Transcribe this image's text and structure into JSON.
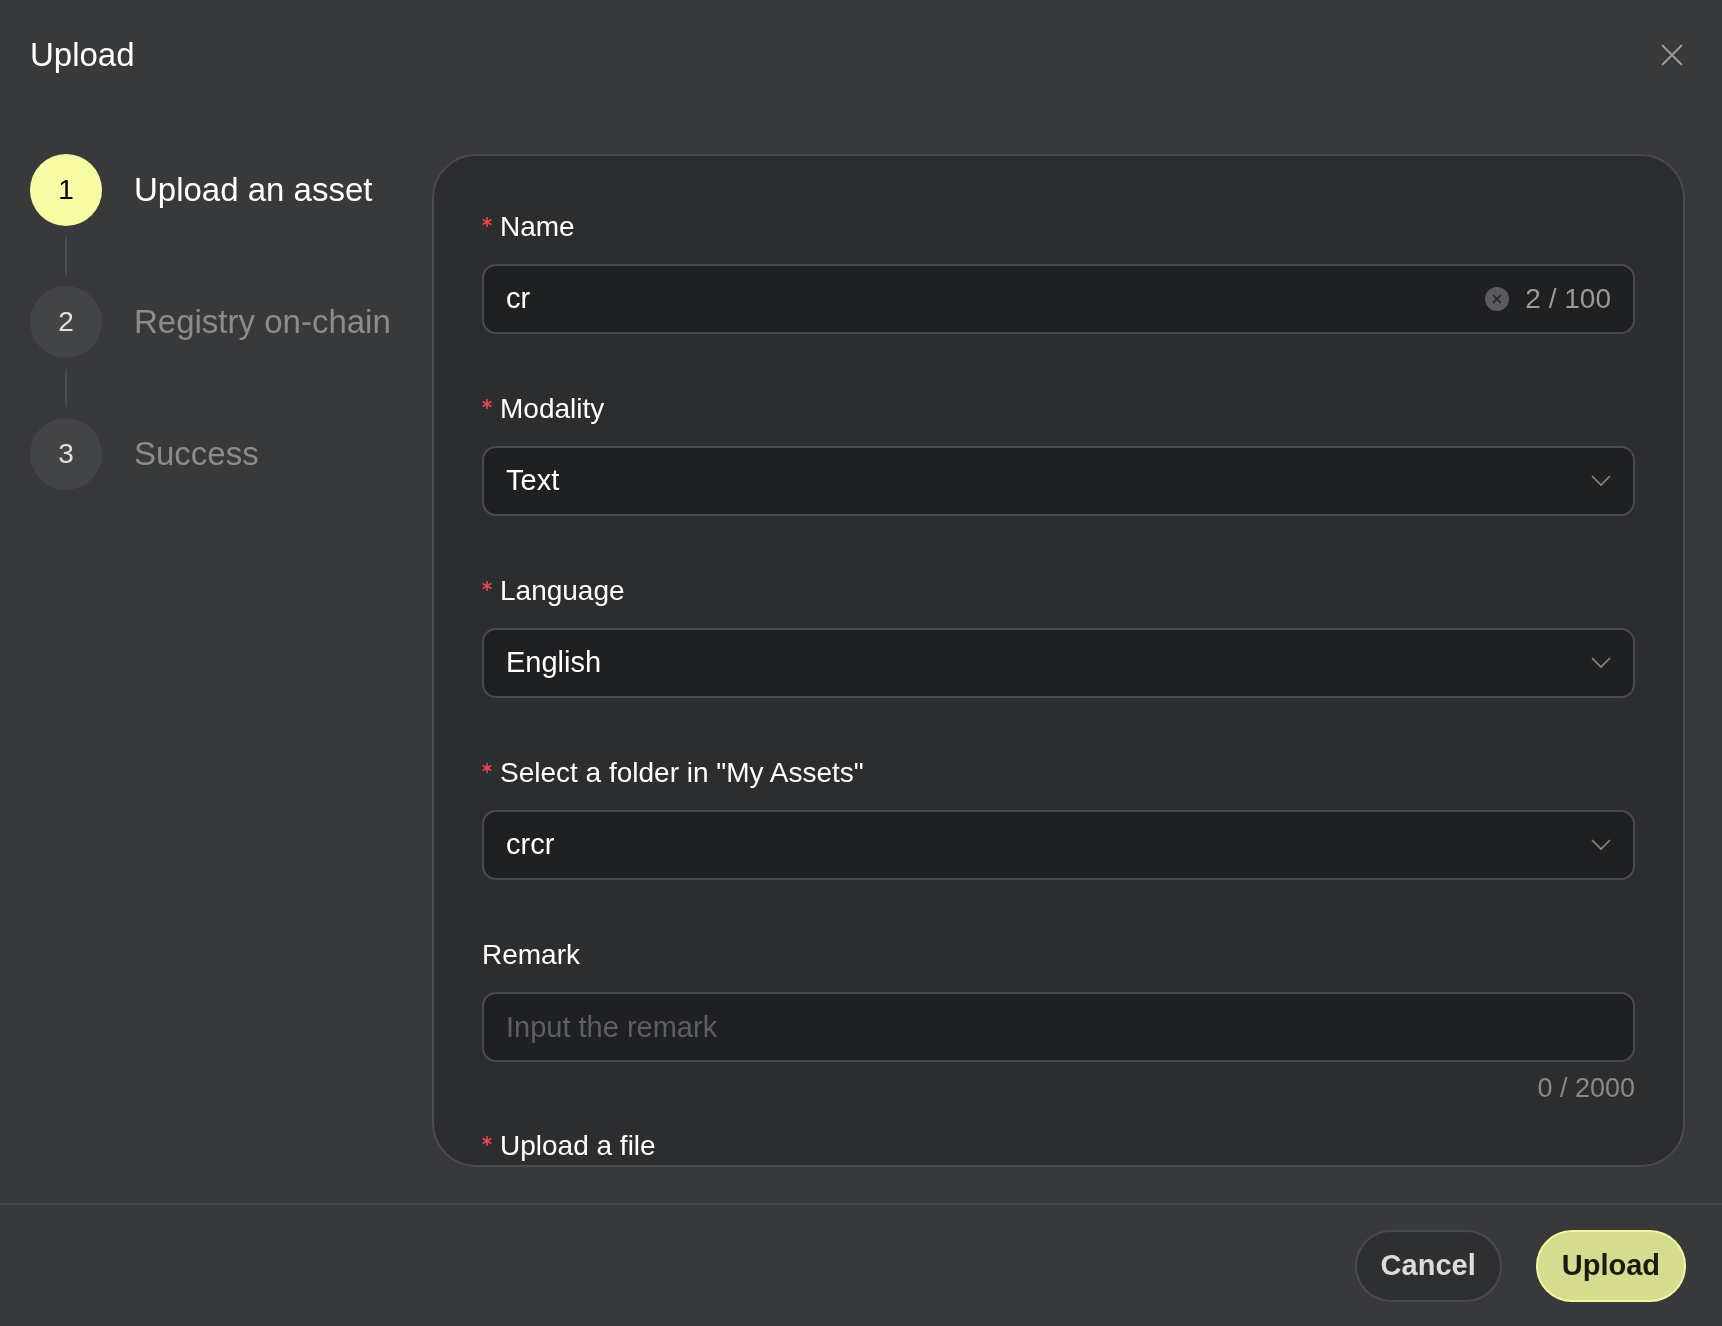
{
  "dialog": {
    "title": "Upload"
  },
  "steps": [
    {
      "number": "1",
      "label": "Upload an asset",
      "selected": true
    },
    {
      "number": "2",
      "label": "Registry on-chain",
      "selected": false
    },
    {
      "number": "3",
      "label": "Success",
      "selected": false
    }
  ],
  "form": {
    "fields": [
      {
        "kind": "text",
        "label": "Name",
        "required": true,
        "value": "cr",
        "counter": "2 / 100"
      },
      {
        "kind": "select",
        "label": "Modality",
        "required": true,
        "value": "Text"
      },
      {
        "kind": "select",
        "label": "Language",
        "required": true,
        "value": "English"
      },
      {
        "kind": "select",
        "label": "Select a folder in \"My Assets\"",
        "required": true,
        "value": "crcr"
      },
      {
        "kind": "textarea",
        "label": "Remark",
        "required": false,
        "placeholder": "Input the remark",
        "counter": "0 / 2000"
      },
      {
        "kind": "file",
        "label": "Upload a file",
        "required": true
      }
    ]
  },
  "buttons": [
    {
      "label": "Cancel",
      "kind": "secondary"
    },
    {
      "label": "Upload",
      "kind": "primary"
    }
  ]
}
